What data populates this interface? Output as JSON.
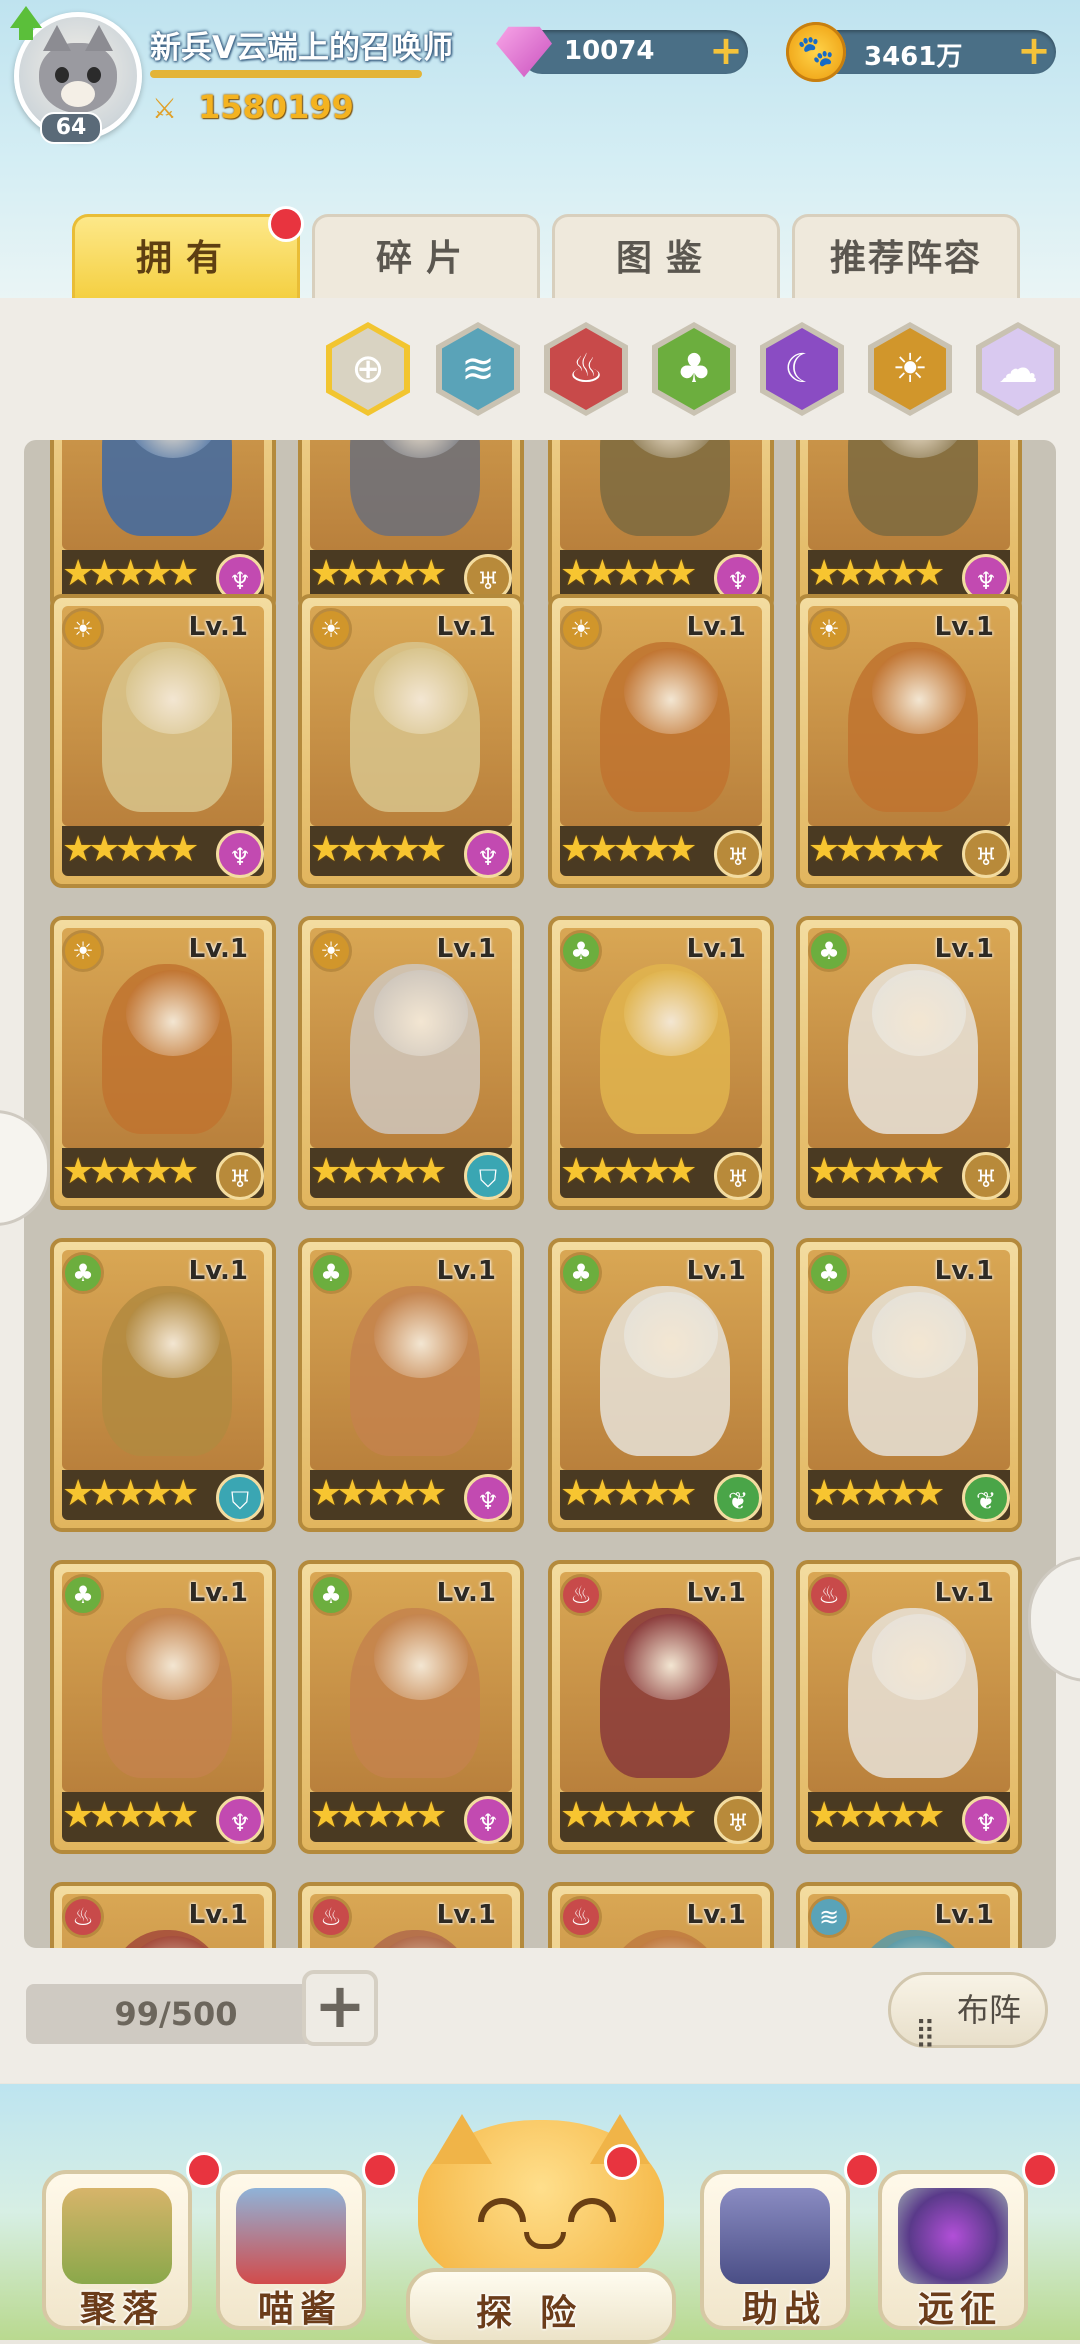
{
  "player": {
    "name": "新兵V云端上的召唤师",
    "level": "64",
    "power": "1580199"
  },
  "resources": {
    "gems": "10074",
    "coins": "3461万"
  },
  "tabs": [
    {
      "label": "拥有",
      "active": true,
      "badge": true
    },
    {
      "label": "碎片",
      "active": false,
      "badge": false
    },
    {
      "label": "图鉴",
      "active": false,
      "badge": false
    },
    {
      "label": "推荐阵容",
      "active": false,
      "badge": false
    }
  ],
  "element_filters": [
    {
      "name": "all",
      "icon": "⊕",
      "color": "#d9d3c2",
      "selected": true
    },
    {
      "name": "water",
      "icon": "≋",
      "color": "#5aa3b8",
      "selected": false
    },
    {
      "name": "fire",
      "icon": "♨",
      "color": "#c84a4a",
      "selected": false
    },
    {
      "name": "wood",
      "icon": "♣",
      "color": "#6cae3e",
      "selected": false
    },
    {
      "name": "dark",
      "icon": "☾",
      "color": "#8a4cc3",
      "selected": false
    },
    {
      "name": "light",
      "icon": "☀",
      "color": "#d1962b",
      "selected": false
    },
    {
      "name": "rainbow",
      "icon": "☁",
      "color": "#d9c9f0",
      "selected": false
    }
  ],
  "hero_rows": [
    [
      {
        "level": "",
        "stars": "★★★★★",
        "class_color": "#c24ab1",
        "class_icon": "♆",
        "elem_icon": "",
        "tone": "#3f6aa3"
      },
      {
        "level": "",
        "stars": "★★★★★",
        "class_color": "#b88a3a",
        "class_icon": "♅",
        "elem_icon": "",
        "tone": "#6b6f7a"
      },
      {
        "level": "",
        "stars": "★★★★★",
        "class_color": "#c24ab1",
        "class_icon": "♆",
        "elem_icon": "",
        "tone": "#7c6a40"
      },
      {
        "level": "",
        "stars": "★★★★★",
        "class_color": "#c24ab1",
        "class_icon": "♆",
        "elem_icon": "",
        "tone": "#7c6a40"
      }
    ],
    [
      {
        "level": "Lv.1",
        "stars": "★★★★★",
        "class_color": "#c24ab1",
        "class_icon": "♆",
        "elem_icon": "☀",
        "tone": "#d8c48c"
      },
      {
        "level": "Lv.1",
        "stars": "★★★★★",
        "class_color": "#c24ab1",
        "class_icon": "♆",
        "elem_icon": "☀",
        "tone": "#d8c48c"
      },
      {
        "level": "Lv.1",
        "stars": "★★★★★",
        "class_color": "#b88a3a",
        "class_icon": "♅",
        "elem_icon": "☀",
        "tone": "#c0732f"
      },
      {
        "level": "Lv.1",
        "stars": "★★★★★",
        "class_color": "#b88a3a",
        "class_icon": "♅",
        "elem_icon": "☀",
        "tone": "#c0732f"
      }
    ],
    [
      {
        "level": "Lv.1",
        "stars": "★★★★★",
        "class_color": "#b88a3a",
        "class_icon": "♅",
        "elem_icon": "☀",
        "tone": "#c0732f"
      },
      {
        "level": "Lv.1",
        "stars": "★★★★★",
        "class_color": "#3aa6b3",
        "class_icon": "⛉",
        "elem_icon": "☀",
        "tone": "#cfc7bd"
      },
      {
        "level": "Lv.1",
        "stars": "★★★★★",
        "class_color": "#b88a3a",
        "class_icon": "♅",
        "elem_icon": "♣",
        "tone": "#e0b44e"
      },
      {
        "level": "Lv.1",
        "stars": "★★★★★",
        "class_color": "#b88a3a",
        "class_icon": "♅",
        "elem_icon": "♣",
        "tone": "#e7e3da"
      }
    ],
    [
      {
        "level": "Lv.1",
        "stars": "★★★★★",
        "class_color": "#3aa6b3",
        "class_icon": "⛉",
        "elem_icon": "♣",
        "tone": "#b1893f"
      },
      {
        "level": "Lv.1",
        "stars": "★★★★★",
        "class_color": "#c24ab1",
        "class_icon": "♆",
        "elem_icon": "♣",
        "tone": "#c4834c"
      },
      {
        "level": "Lv.1",
        "stars": "★★★★★",
        "class_color": "#4aa548",
        "class_icon": "❦",
        "elem_icon": "♣",
        "tone": "#e6e2d8"
      },
      {
        "level": "Lv.1",
        "stars": "★★★★★",
        "class_color": "#4aa548",
        "class_icon": "❦",
        "elem_icon": "♣",
        "tone": "#e6e2d8"
      }
    ],
    [
      {
        "level": "Lv.1",
        "stars": "★★★★★",
        "class_color": "#c24ab1",
        "class_icon": "♆",
        "elem_icon": "♣",
        "tone": "#c4834c"
      },
      {
        "level": "Lv.1",
        "stars": "★★★★★",
        "class_color": "#c24ab1",
        "class_icon": "♆",
        "elem_icon": "♣",
        "tone": "#c4834c"
      },
      {
        "level": "Lv.1",
        "stars": "★★★★★",
        "class_color": "#b88a3a",
        "class_icon": "♅",
        "elem_icon": "♨",
        "tone": "#8a3a3a"
      },
      {
        "level": "Lv.1",
        "stars": "★★★★★",
        "class_color": "#c24ab1",
        "class_icon": "♆",
        "elem_icon": "♨",
        "tone": "#e8e2d8"
      }
    ],
    [
      {
        "level": "Lv.1",
        "stars": "",
        "class_color": "#b88a3a",
        "class_icon": "",
        "elem_icon": "♨",
        "tone": "#a34a3a"
      },
      {
        "level": "Lv.1",
        "stars": "",
        "class_color": "#b88a3a",
        "class_icon": "",
        "elem_icon": "♨",
        "tone": "#b06a4a"
      },
      {
        "level": "Lv.1",
        "stars": "",
        "class_color": "#b88a3a",
        "class_icon": "",
        "elem_icon": "♨",
        "tone": "#c07a40"
      },
      {
        "level": "Lv.1",
        "stars": "",
        "class_color": "#b88a3a",
        "class_icon": "",
        "elem_icon": "≋",
        "tone": "#5a9aa8"
      }
    ]
  ],
  "inventory": {
    "count": "99/500",
    "formation_label": "布阵"
  },
  "bottom_nav": [
    {
      "label": "聚落",
      "badge": true
    },
    {
      "label": "喵酱",
      "badge": true
    },
    {
      "label": "探险",
      "badge": true
    },
    {
      "label": "助战",
      "badge": true
    },
    {
      "label": "远征",
      "badge": true
    }
  ]
}
